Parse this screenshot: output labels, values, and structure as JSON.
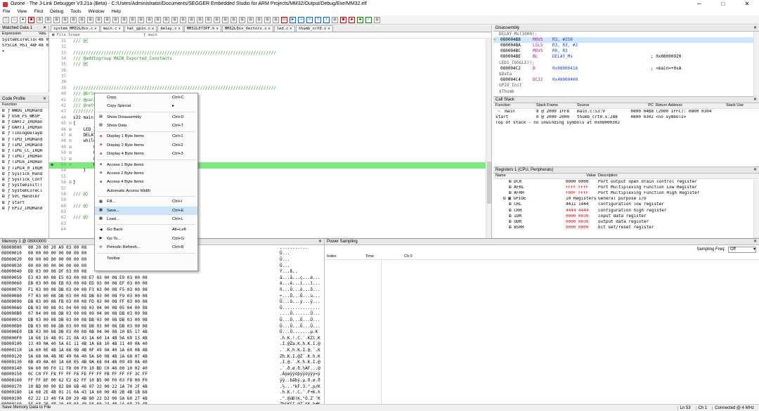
{
  "window": {
    "title": "Ozone - The J-Link Debugger V3.21a (Beta) - C:/Users/Administrator/Documents/SEGGER Embedded Studio for ARM Projects/MM32/Output/Debug/Exe/MM32.elf",
    "min": "─",
    "max": "□",
    "close": "✕"
  },
  "menu": [
    "File",
    "View",
    "Find",
    "Debug",
    "Tools",
    "Window",
    "Help"
  ],
  "watched": {
    "title": "Watched Data 1",
    "cols": [
      "Expression",
      "Valu"
    ],
    "rows": [
      [
        "SystemCoreClock",
        "48 0"
      ],
      [
        "SYSCLK_HSI_48MHz",
        "48 0"
      ]
    ],
    "expand": "▸"
  },
  "code_profile": {
    "title": "Code Profile",
    "col": "Function",
    "rows": [
      "WWDG_IRQHand",
      "USB_FS_WKUP_",
      "UART2_IRQHan",
      "UART1_IRQHan",
      "TimingDelayD",
      "TIM3_IRQHand",
      "TIM2_IRQHand",
      "TIM1_CC_IRQH",
      "TIM17_IRQHan",
      "TIM16_IRQHan",
      "TIM14_0_IRQH",
      "SysTick_Hand",
      "SysTick_Conf",
      "SystemInit()",
      "SystemCoreCl",
      "SVC_Handler",
      "start",
      "EPI2_IRQHand"
    ]
  },
  "tabs": [
    "system_MM32L0xx.c",
    "main.c",
    "hal_gpio.c",
    "delay.c",
    "MM32L073PF.h",
    "MM32L0xx_Vectors.s",
    "led.c",
    "thumb_crt0.s"
  ],
  "scope": {
    "file": "File Scope",
    "func": "main"
  },
  "code": [
    {
      "n": "31",
      "t": "/// @{",
      "c": true
    },
    {
      "n": "32",
      "t": "",
      "c": false
    },
    {
      "n": "33",
      "t": "////////////////////////////////////////////////////////////////////////////////",
      "c": true
    },
    {
      "n": "34",
      "t": "/// @addtogroup MAIN_Exported_Constants",
      "c": true
    },
    {
      "n": "35",
      "t": "/// @{",
      "c": true
    },
    {
      "n": "36",
      "t": "",
      "c": false
    },
    {
      "n": "37",
      "t": "",
      "c": false
    },
    {
      "n": "38",
      "t": "",
      "c": false
    },
    {
      "n": "39",
      "t": "////////////////////////////////////////////////////////////////////////////////",
      "c": true
    },
    {
      "n": "40",
      "t": "/// @brie",
      "c": true
    },
    {
      "n": "41",
      "t": "/// @para",
      "c": true
    },
    {
      "n": "42",
      "t": "/// @retv",
      "c": true
    },
    {
      "n": "43",
      "t": "////////",
      "c": true
    },
    {
      "n": "44",
      "t": "s32 main(",
      "c": false
    },
    {
      "n": "45",
      "t": "{",
      "c": false
    },
    {
      "n": "46",
      "t": "    LED_I",
      "c": false
    },
    {
      "n": "47",
      "t": "    DELAY",
      "c": false
    },
    {
      "n": "48",
      "t": "    while",
      "c": false
    },
    {
      "n": "49",
      "t": "        L",
      "c": false
    },
    {
      "n": "50",
      "t": "        L",
      "c": false
    },
    {
      "n": "51",
      "t": "        L",
      "c": false
    },
    {
      "n": "53",
      "t": "        D",
      "c": false
    },
    {
      "n": "54",
      "t": "    }",
      "c": false
    },
    {
      "n": "55",
      "t": "",
      "c": false
    },
    {
      "n": "56",
      "t": "}",
      "c": false
    },
    {
      "n": "57",
      "t": "",
      "c": false
    },
    {
      "n": "58",
      "t": "/// @}",
      "c": true
    },
    {
      "n": "59",
      "t": "",
      "c": false
    },
    {
      "n": "60",
      "t": "/// @}",
      "c": true
    },
    {
      "n": "61",
      "t": "",
      "c": false
    },
    {
      "n": "62",
      "t": "/// @}",
      "c": true
    },
    {
      "n": "63",
      "t": "",
      "c": false
    },
    {
      "n": "64",
      "t": "",
      "c": false
    }
  ],
  "context_menu": [
    {
      "l": "Copy",
      "s": "Ctrl+C",
      "i": ""
    },
    {
      "l": "Copy Special",
      "s": "▸",
      "i": ""
    },
    {
      "sep": true
    },
    {
      "l": "Show Disassembly",
      "s": "Ctrl+D",
      "i": "▤"
    },
    {
      "l": "Show Data",
      "s": "Ctrl+T",
      "i": "▤"
    },
    {
      "sep": true
    },
    {
      "l": "Display 1 Byte Items",
      "s": "Ctrl+1",
      "i": "■",
      "c": "#d33"
    },
    {
      "l": "Display 2 Byte Items",
      "s": "Ctrl+2",
      "i": "■",
      "c": "#d33"
    },
    {
      "l": "Display 4 Byte Items",
      "s": "Ctrl+3",
      "i": "■",
      "c": "#d33"
    },
    {
      "sep": true
    },
    {
      "l": "Access 1 Byte Items",
      "s": "",
      "i": "■",
      "c": "#36c"
    },
    {
      "l": "Access 2 Byte Items",
      "s": "",
      "i": "■",
      "c": "#36c"
    },
    {
      "l": "Access 4 Byte Items",
      "s": "",
      "i": "■",
      "c": "#36c"
    },
    {
      "l": "Automatic Access Width",
      "s": "",
      "i": ""
    },
    {
      "sep": true
    },
    {
      "l": "Fill...",
      "s": "Ctrl+I",
      "i": "▦"
    },
    {
      "l": "Save...",
      "s": "Ctrl+E",
      "i": "▦",
      "sel": true
    },
    {
      "l": "Load...",
      "s": "Ctrl+L",
      "i": "▦"
    },
    {
      "sep": true
    },
    {
      "l": "Go Back",
      "s": "Alt+Left",
      "i": "◀"
    },
    {
      "l": "Go To...",
      "s": "Ctrl+G",
      "i": "▶"
    },
    {
      "l": "Periodic Refresh...",
      "s": "Ctrl+R",
      "i": "⟳"
    },
    {
      "sep": true
    },
    {
      "l": "Toolbar",
      "s": "",
      "i": ""
    }
  ],
  "disasm": {
    "title": "Disassembly",
    "rows": [
      {
        "a": "DELAY_Ms(1000);",
        "k": "label"
      },
      {
        "a": "080004B8",
        "m": "MOVS",
        "o": "R3, #250",
        "x": "",
        "k": "cur"
      },
      {
        "a": "080004BA",
        "m": "LSLS",
        "o": "R3, R3, #2",
        "x": ""
      },
      {
        "a": "080004BC",
        "m": "MOVS",
        "o": "R0, R3",
        "x": ""
      },
      {
        "a": "080004BE",
        "m": "BL",
        "o": "DELAY_Ms",
        "x": "; 0x08000920"
      },
      {
        "a": "LED1_TOGGLE();",
        "k": "label"
      },
      {
        "a": "080004C2",
        "m": "B",
        "o": "0x08000416",
        "x": "; <main>+0xA"
      },
      {
        "a": "$Data",
        "k": "label"
      },
      {
        "a": "080004C4",
        "m": "DC32",
        "o": "0x48000400",
        "x": ""
      },
      {
        "a": "GPIO_Init",
        "k": "label"
      },
      {
        "a": "$Thumb",
        "k": "label"
      }
    ]
  },
  "callstack": {
    "title": "Call Stack",
    "cols": [
      "Function",
      "Stack Frame",
      "Source",
      "PC",
      "Return Address",
      "Stack Use"
    ],
    "rows": [
      [
        "main",
        "8 @ 2000 1FF8",
        "main.c:53:9",
        "0800 04B8",
        "(2000 1FFC): 0800 0304"
      ],
      [
        "start",
        "0 @ 2000 2000",
        "thumb_crt0.s:288",
        "0800 0302",
        "<no symbols>"
      ]
    ],
    "note": "Top of stack - no unwinding symbols at 0x08000302"
  },
  "registers": {
    "title": "Registers 1 (CPU, Peripherals)",
    "cols": [
      "Name",
      "Value",
      "Description"
    ],
    "rows": [
      {
        "n": "DCR",
        "v": "0000 0000",
        "d": "Port output open drain control register",
        "r": false,
        "ind": 2
      },
      {
        "n": "AFRL",
        "v": "FFFF FFFF",
        "d": "Port Multiplexing Function Low Register",
        "r": true,
        "ind": 2
      },
      {
        "n": "AFRH",
        "v": "F00F FFFF",
        "d": "Port Multiplexing Function High Register",
        "r": true,
        "ind": 2
      },
      {
        "n": "GPIOE",
        "v": "10 Registers",
        "d": "General purpose I/O",
        "r": false,
        "ind": 1
      },
      {
        "n": "CRL",
        "v": "4411 1444",
        "d": "configuration low register",
        "r": false,
        "ind": 2
      },
      {
        "n": "CRH",
        "v": "4444 4444",
        "d": "configuration high register",
        "r": true,
        "ind": 2
      },
      {
        "n": "IDR",
        "v": "0000 0030",
        "d": "input data register",
        "r": true,
        "ind": 2
      },
      {
        "n": "ODR",
        "v": "0000 0030",
        "d": "output data register",
        "r": true,
        "ind": 2
      },
      {
        "n": "BSRR",
        "v": "0000 0000",
        "d": "bit set/reset register",
        "r": true,
        "ind": 2
      }
    ]
  },
  "memory": {
    "title": "Memory 1 @ 08000000",
    "rows": [
      [
        "08000000",
        "00 20 00 20 A9 03 00 08 ",
        "..........."
      ],
      [
        "08000010",
        "00 00 00 00 00 00 00 00 ",
        "Û..."
      ],
      [
        "08000020",
        "00 00 00 00 00 00 00 00 ",
        "Û..."
      ],
      [
        "08000030",
        "00 00 00 00 00 00 00 00 ",
        "Û..."
      ],
      [
        "08000040",
        "DD 03 00 08 DF 03 00 08 ",
        "Ý...ß.."
      ],
      [
        "08000050",
        "E3 03 00 08 E5 03 00 08 E7 03 00 08 E9 03 00 08",
        "ã...å...ç...é..."
      ],
      [
        "08000060",
        "EB 03 00 08 EB 03 00 08 ED 03 00 08 EF 03 00 08",
        "ë...ë...í...ï..."
      ],
      [
        "08000070",
        "F1 03 00 08 DB 03 00 08 F3 03 00 08 F5 03 00 08",
        "ñ...Û...ó...õ..."
      ],
      [
        "08000080",
        "F7 03 00 08 DB 03 00 08 DB 03 00 08 F9 03 00 08",
        "÷...Û...Û...ù..."
      ],
      [
        "08000090",
        "DB 03 00 08 FB 03 00 08 FD 03 00 08 FF 03 00 08",
        "Û...û...ý...ÿ..."
      ],
      [
        "080000A0",
        "DB 03 00 08 01 04 00 08 03 04 00 08 05 04 00 08",
        "Û..............."
      ],
      [
        "080000B0",
        "07 04 00 08 DB 03 00 08 09 04 00 08 DB 03 00 08",
        "....Û.......Û..."
      ],
      [
        "080000C0",
        "DB 03 00 08 DB 03 00 08 DB 03 00 08 DB 03 00 08",
        "Û...Û...Û...Û..."
      ],
      [
        "080000D0",
        "DB 03 00 08 DB 03 00 08 DB 03 00 08 DB 03 00 08",
        "Û...Û...Û...Û..."
      ],
      [
        "080000E0",
        "DB 03 00 08 DB 03 00 08 0B 04 00 08 10 B5 17 4B",
        "Û...Û.......µ.K"
      ],
      [
        "080000F0",
        "1A 68 16 4B 01 21 0A 43 1A 60 14 4B 5A 69 13 4B",
        ".h.K.!.C.`.KZi.K"
      ],
      [
        "08000100",
        "13 49 0A 40 5A 61 11 4B 1A 68 10 4B 11 49 0A 40",
        ".I.@Za.K.h.K.I.@"
      ],
      [
        "08000110",
        "1A 60 0E 4B 1A 68 0D 4B 0F 49 0A 40 1A 60 0B 4B",
        ".`.K.h.K.I.@.`.K"
      ],
      [
        "08000120",
        "5A 68 0A 4B 0D 49 0A 40 5A 60 08 4B 1A 68 07 4B",
        "Zh.K.I.@Z`.K.h.K"
      ],
      [
        "08000130",
        "0B 49 0A 40 1A 60 05 4B 9A 68 04 4B 09 49 0A 40",
        ".I.@.`.K.h.K.I.@"
      ],
      [
        "08000140",
        "9A 60 00 F0 11 F8 00 F0 10 BD C0 46 00 10 02 40",
        ".`.ð.ø.ð.½ÀF...@"
      ],
      [
        "08000150",
        "0C C0 FF F8 FF FF F6 FE FF FF FB FF FF FF 3C FF",
        ".Àÿøÿÿöþÿÿûÿÿÿ<ÿ"
      ],
      [
        "08000160",
        "FF FF 8F 00 62 E2 62 FF 10 B5 00 F0 03 F8 00 F0",
        "ÿÿ..bâbÿ.µ.ð.ø.ð"
      ],
      [
        "08000170",
        "10 BD 00 00 82 B0 6B 46 07 33 00 22 1A 70 2F 4B",
        ".½...°kF.3.\".p/K"
      ],
      [
        "08000180",
        "1A 68 2E 4B 01 21 0A 43 1A 60 00 46 2B 4B 1B 68",
        ".h.K.!.C.`.F+K.h"
      ],
      [
        "08000190",
        "02 22 13 40 FA D0 29 4B 80 22 D2 00 5A 60 27 4B",
        ".\".@úÐ)K.\"Ò.Z`'K"
      ],
      [
        "080001A0",
        "5A 68 26 4B 26 49 0A 40 5A 60 24 4B 1A 68 23 4B",
        "Zh&K&I.@Z`$K.h#K"
      ],
      [
        "080001B0",
        "24 49 0A 40 1A 60 21 4B 1A 68 20 4B 22 49 0A 40",
        "$I.@.`!K.h K\"I.@"
      ],
      [
        "080001C0",
        "1A 60 1E 4B 1A 68 1D 4B 1F 49 0A 40 1A 60 1B 4B",
        ".`.K.h.K.I.@.`.K"
      ]
    ]
  },
  "power": {
    "title": "Power Sampling",
    "freq_label": "Sampling Freq:",
    "freq_value": "Off",
    "cols": [
      "Index",
      "Time",
      "Ch 0"
    ]
  },
  "status": {
    "left": "Save Memory Data to File",
    "ln": "Ln 53",
    "ch": "Ch 1",
    "conn": "Connected @ 4 MHz"
  },
  "colors": {
    "highlight": "#7fe87f",
    "accent": "#1a3fd0",
    "changed": "#e00000"
  }
}
